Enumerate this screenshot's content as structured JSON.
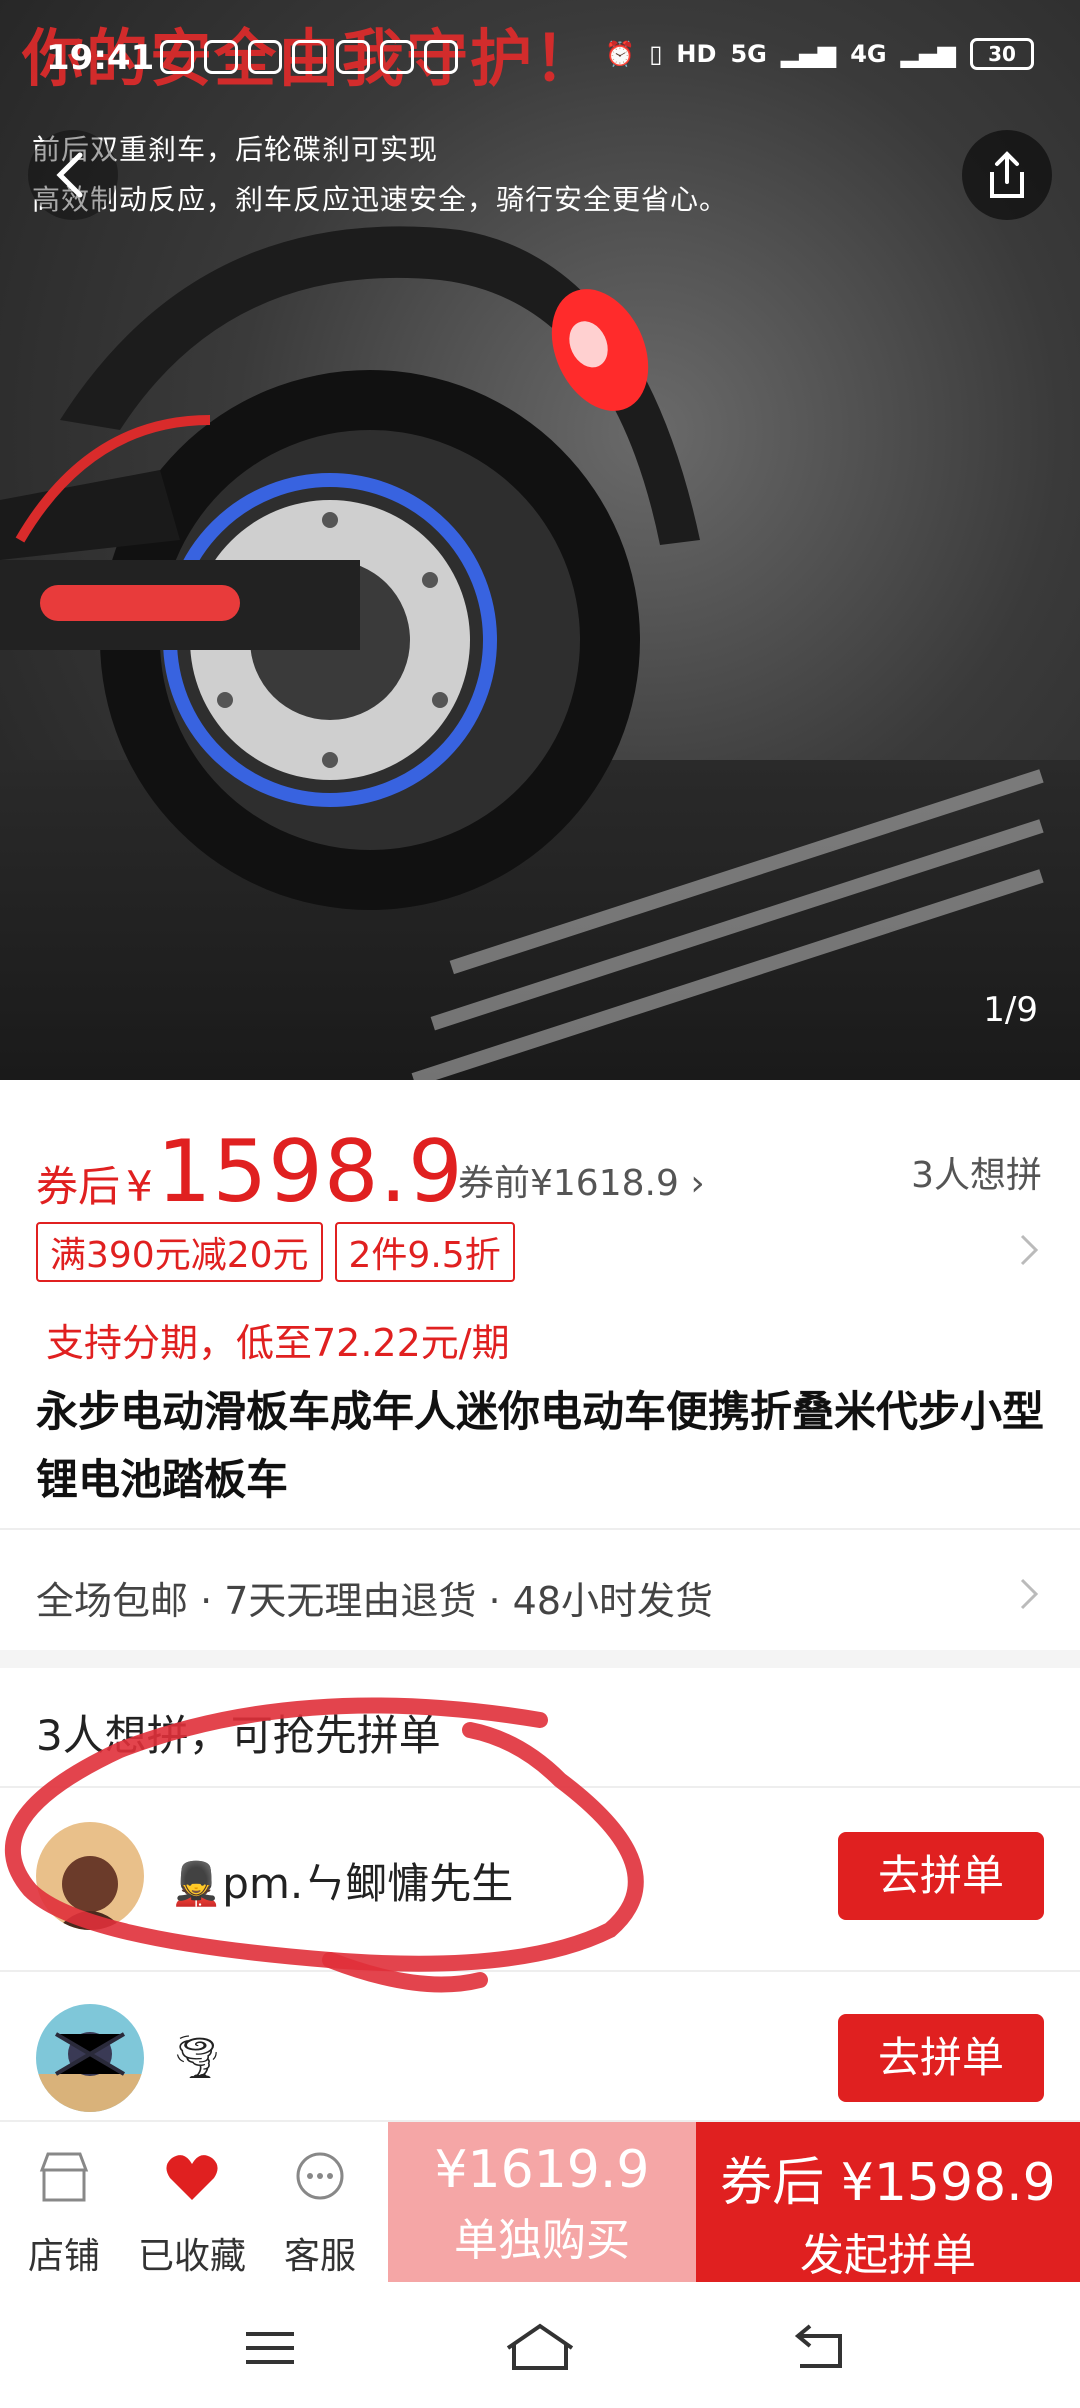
{
  "status_bar": {
    "time": "19:41",
    "network_hd": "HD",
    "network_5g": "5G",
    "network_4g": "4G",
    "battery": "30"
  },
  "hero": {
    "overlay_title": "你的安全由我守护！",
    "line1": "前后双重刹车，后轮碟刹可实现",
    "line2": "高效制动反应，刹车反应迅速安全，骑行安全更省心。",
    "counter": "1/9"
  },
  "price": {
    "after_label": "券后",
    "yen": "¥",
    "after_value": "1598.9",
    "before_text": "券前¥1618.9",
    "wish_count": "3人想拼"
  },
  "tags": [
    "满390元减20元",
    "2件9.5折"
  ],
  "installment": "支持分期，低至72.22元/期",
  "product_title": "永步电动滑板车成年人迷你电动车便携折叠米代步小型锂电池踏板车",
  "services": "全场包邮 · 7天无理由退货 · 48小时发货",
  "group": {
    "header": "3人想拼，可抢先拼单",
    "rows": [
      {
        "name": "💂pm.ㄣ鲫慵先生",
        "button": "去拼单"
      },
      {
        "name": "🌪",
        "button": "去拼单"
      }
    ]
  },
  "bottom_bar": {
    "store": "店铺",
    "favorited": "已收藏",
    "service": "客服",
    "alone_price": "¥1619.9",
    "alone_label": "单独购买",
    "group_price": "券后 ¥1598.9",
    "group_label": "发起拼单"
  },
  "colors": {
    "accent_red": "#e02020",
    "alone_pink": "#f5a6a6"
  }
}
